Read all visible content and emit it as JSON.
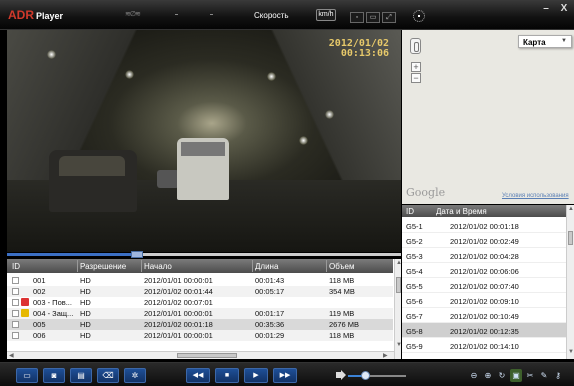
{
  "app": {
    "logo": "ADR",
    "logo_sub": "Player"
  },
  "titlebar": {
    "speed_label": "Скорость",
    "unit": "km/h",
    "minimize": "–",
    "close": "X"
  },
  "video": {
    "date": "2012/01/02",
    "time": "00:13:06"
  },
  "seek": {
    "progress": 0.33
  },
  "files": {
    "columns": [
      "ID",
      "Разрешение",
      "Начало",
      "Длина",
      "Объем"
    ],
    "rows": [
      {
        "id": "001",
        "res": "HD",
        "start": "2012/01/01 00:00:01",
        "len": "00:01:43",
        "size": "118 MB",
        "icon": ""
      },
      {
        "id": "002",
        "res": "HD",
        "start": "2012/01/02 00:01:44",
        "len": "00:05:17",
        "size": "354 MB",
        "icon": ""
      },
      {
        "id": "003 - Пов...",
        "res": "HD",
        "start": "2012/01/02 00:07:01",
        "len": "",
        "size": "",
        "icon": "red"
      },
      {
        "id": "004 - Защ...",
        "res": "HD",
        "start": "2012/01/01 00:00:01",
        "len": "00:01:17",
        "size": "119 MB",
        "icon": "yellow"
      },
      {
        "id": "005",
        "res": "HD",
        "start": "2012/01/02 00:01:18",
        "len": "00:35:36",
        "size": "2676 MB",
        "icon": ""
      },
      {
        "id": "006",
        "res": "HD",
        "start": "2012/01/01 00:00:01",
        "len": "00:01:29",
        "size": "118 MB",
        "icon": ""
      }
    ]
  },
  "map": {
    "type_label": "Карта",
    "google": "Google",
    "terms": "Условия использования"
  },
  "gps": {
    "columns": [
      "ID",
      "Дата и Время"
    ],
    "rows": [
      {
        "id": "G5-1",
        "dt": "2012/01/02 00:01:18"
      },
      {
        "id": "G5-2",
        "dt": "2012/01/02 00:02:49"
      },
      {
        "id": "G5-3",
        "dt": "2012/01/02 00:04:28"
      },
      {
        "id": "G5-4",
        "dt": "2012/01/02 00:06:06"
      },
      {
        "id": "G5-5",
        "dt": "2012/01/02 00:07:40"
      },
      {
        "id": "G5-6",
        "dt": "2012/01/02 00:09:10"
      },
      {
        "id": "G5-7",
        "dt": "2012/01/02 00:10:49"
      },
      {
        "id": "G5-8",
        "dt": "2012/01/02 00:12:35"
      },
      {
        "id": "G5-9",
        "dt": "2012/01/02 00:14:10"
      }
    ],
    "selected_index": 7
  },
  "toolbar": {
    "left_icons": [
      "folder-icon",
      "camera-icon",
      "save-icon",
      "trash-icon",
      "settings-icon"
    ],
    "rewind": "◀◀",
    "stop": "■",
    "play": "▶",
    "forward": "▶▶",
    "volume": 0.3,
    "right_icons": [
      "link-icon",
      "network-icon",
      "refresh-icon",
      "folder-open-icon",
      "cut-icon",
      "edit-icon",
      "key-icon"
    ]
  },
  "colors": {
    "accent": "#1f4f97",
    "logo_red": "#d0392b",
    "timestamp": "#e7c96a"
  }
}
